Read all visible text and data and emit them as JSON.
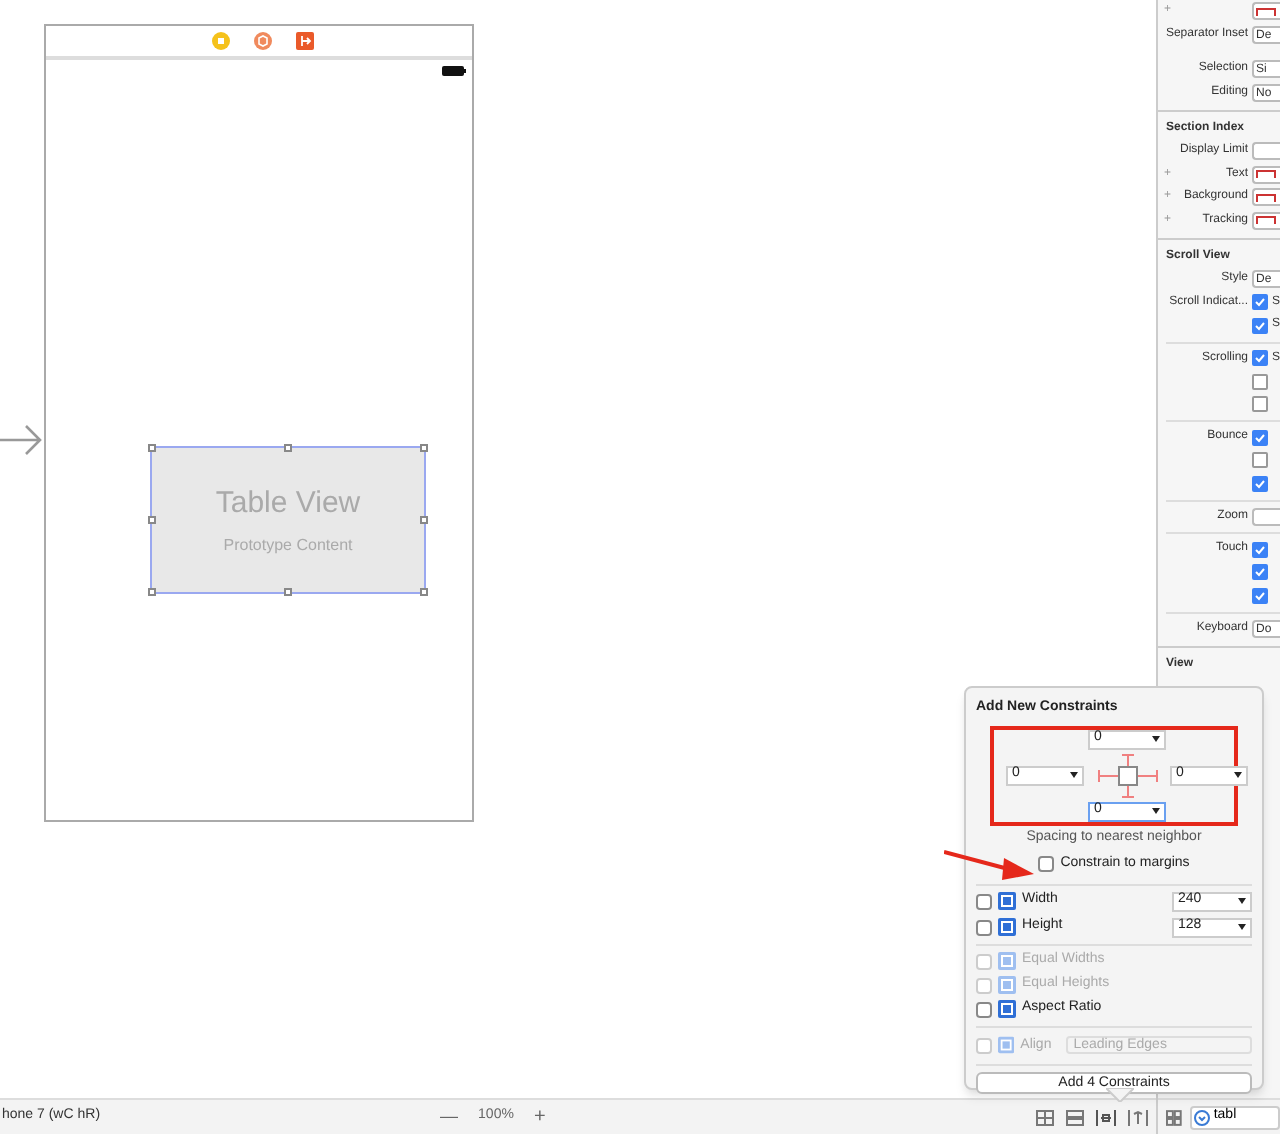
{
  "table_view": {
    "title": "Table View",
    "subtitle": "Prototype Content"
  },
  "canvas_bar": {
    "device": "hone 7 (wC hR)",
    "zoom_out": "—",
    "zoom": "100%",
    "zoom_in": "+"
  },
  "inspector": {
    "sections": [
      {
        "rows": [
          {
            "kind": "color",
            "label": "",
            "plus": "+"
          },
          {
            "kind": "field",
            "label": "Separator Inset",
            "value": "De"
          },
          {
            "kind": "gap"
          },
          {
            "kind": "field",
            "label": "Selection",
            "value": "Si"
          },
          {
            "kind": "field",
            "label": "Editing",
            "value": "No"
          }
        ]
      },
      {
        "header": "Section Index",
        "rows": [
          {
            "kind": "field",
            "label": "Display Limit",
            "value": ""
          },
          {
            "kind": "color",
            "label": "Text",
            "plus": "+"
          },
          {
            "kind": "color",
            "label": "Background",
            "plus": "+"
          },
          {
            "kind": "color",
            "label": "Tracking",
            "plus": "+"
          }
        ]
      },
      {
        "header": "Scroll View",
        "rows": [
          {
            "kind": "field",
            "label": "Style",
            "value": "De"
          },
          {
            "kind": "check",
            "label": "Scroll Indicat...",
            "checked": true,
            "value": "S"
          },
          {
            "kind": "check",
            "label": "",
            "checked": true,
            "value": "S"
          },
          {
            "kind": "rule"
          },
          {
            "kind": "check",
            "label": "Scrolling",
            "checked": true,
            "value": "S"
          },
          {
            "kind": "check",
            "label": "",
            "checked": false
          },
          {
            "kind": "check",
            "label": "",
            "checked": false
          },
          {
            "kind": "rule"
          },
          {
            "kind": "check",
            "label": "Bounce",
            "checked": true
          },
          {
            "kind": "check",
            "label": "",
            "checked": false
          },
          {
            "kind": "check",
            "label": "",
            "checked": true
          },
          {
            "kind": "rule"
          },
          {
            "kind": "field",
            "label": "Zoom",
            "value": ""
          },
          {
            "kind": "rule"
          },
          {
            "kind": "check",
            "label": "Touch",
            "checked": true
          },
          {
            "kind": "check",
            "label": "",
            "checked": true
          },
          {
            "kind": "check",
            "label": "",
            "checked": true
          },
          {
            "kind": "rule"
          },
          {
            "kind": "field",
            "label": "Keyboard",
            "value": "Do"
          }
        ]
      },
      {
        "header": "View"
      }
    ]
  },
  "popover": {
    "title": "Add New Constraints",
    "spacing": [
      {
        "value": "0",
        "focused": false
      },
      {
        "value": "0",
        "focused": false
      },
      {
        "value": "0",
        "focused": false
      },
      {
        "value": "0",
        "focused": true
      }
    ],
    "spacing_caption": "Spacing to nearest neighbor",
    "constrain_to_margins": {
      "label": "Constrain to margins",
      "checked": false
    },
    "size_rows": [
      {
        "label": "Width",
        "checked": false,
        "value": "240"
      },
      {
        "label": "Height",
        "checked": false,
        "value": "128"
      }
    ],
    "options": [
      {
        "label": "Equal Widths",
        "checked": false,
        "disabled": true
      },
      {
        "label": "Equal Heights",
        "checked": false,
        "disabled": true
      },
      {
        "label": "Aspect Ratio",
        "checked": false,
        "disabled": false
      }
    ],
    "align": {
      "label": "Align",
      "value": "Leading Edges",
      "checked": false,
      "disabled": true
    },
    "add_button": "Add 4 Constraints"
  },
  "inspector_bar": {
    "search": "tabl"
  }
}
